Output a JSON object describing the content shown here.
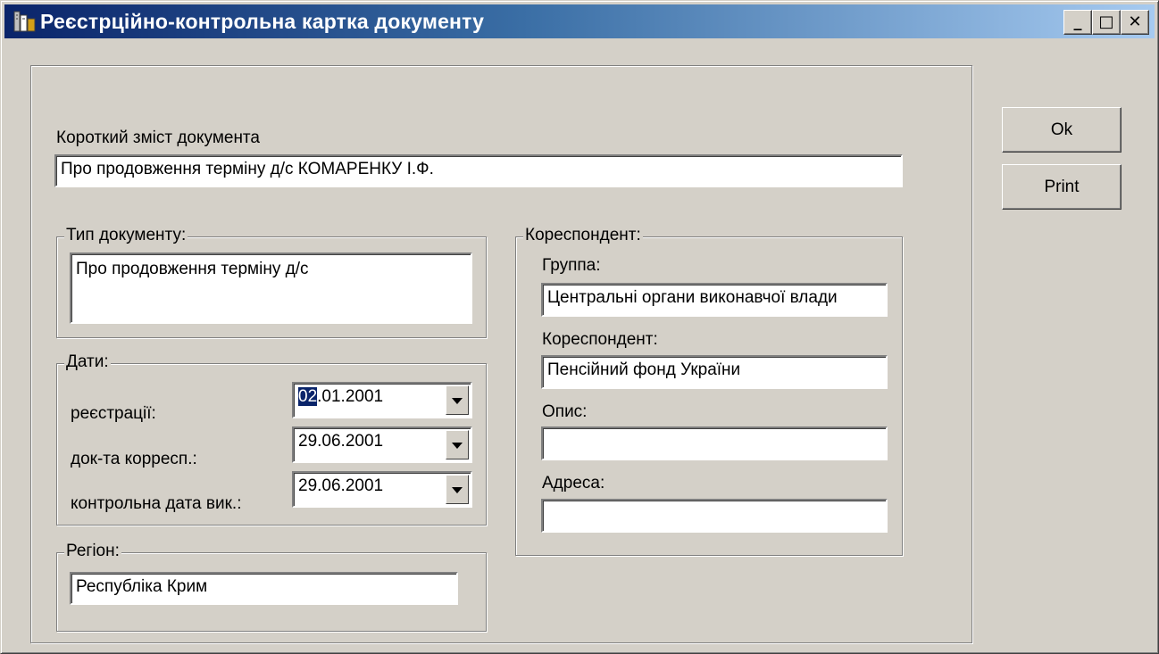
{
  "window": {
    "title": "Реєстрційно-контрольна картка документу",
    "controls": {
      "minimize": "_",
      "maximize": "□",
      "close": "✕"
    }
  },
  "summary": {
    "label": "Короткий зміст документа",
    "value": "Про продовження терміну д/с КОМАРЕНКУ І.Ф."
  },
  "doc_type": {
    "legend": "Тип документу:",
    "value": "Про продовження терміну д/с"
  },
  "dates": {
    "legend": "Дати:",
    "registration": {
      "label": "реєстрації:",
      "value_selected": "02",
      "value_rest": ".01.2001"
    },
    "correspondent_doc": {
      "label": "док-та корресп.:",
      "value": "29.06.2001"
    },
    "control_date": {
      "label": "контрольна дата вик.:",
      "value": "29.06.2001"
    }
  },
  "region": {
    "legend": "Регіон:",
    "value": "Республіка Крим"
  },
  "correspondent": {
    "legend": "Кореспондент:",
    "group": {
      "label": "Группа:",
      "value": "Центральні органи виконавчої влади"
    },
    "correspondent": {
      "label": "Кореспондент:",
      "value": "Пенсійний фонд України"
    },
    "description": {
      "label": "Опис:",
      "value": ""
    },
    "address": {
      "label": "Адреса:",
      "value": ""
    }
  },
  "buttons": {
    "ok": "Ok",
    "print": "Print"
  },
  "icons": {
    "app": "building-icon",
    "combo": "chevron-down-icon"
  }
}
